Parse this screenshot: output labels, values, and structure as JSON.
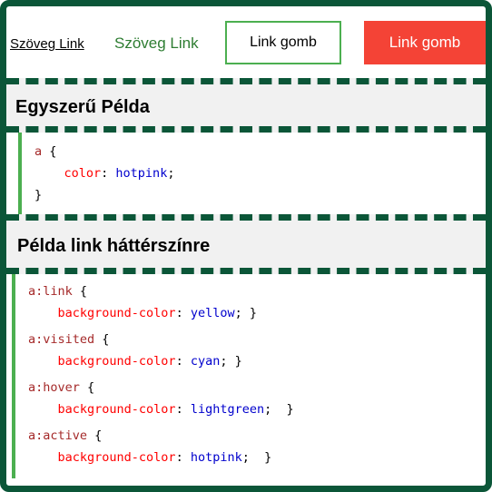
{
  "nav": {
    "link_plain": "Szöveg Link",
    "link_green": "Szöveg Link",
    "button_outline": "Link gomb",
    "button_red": "Link gomb"
  },
  "section1": {
    "title": "Egyszerű Példa",
    "code": {
      "selector": "a",
      "property": "color",
      "value": "hotpink"
    }
  },
  "section2": {
    "title": "Példa link háttérszínre",
    "rules": [
      {
        "selector": "a:link",
        "property": "background-color",
        "value": "yellow"
      },
      {
        "selector": "a:visited",
        "property": "background-color",
        "value": "cyan"
      },
      {
        "selector": "a:hover",
        "property": "background-color",
        "value": "lightgreen"
      },
      {
        "selector": "a:active",
        "property": "background-color",
        "value": "hotpink"
      }
    ]
  },
  "colors": {
    "frame": "#0b5638",
    "accent_green": "#4caf50",
    "button_red": "#f44336"
  }
}
